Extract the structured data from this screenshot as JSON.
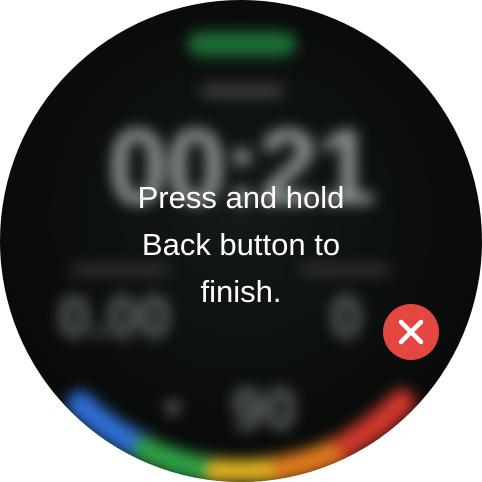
{
  "message": {
    "line1": "Press and hold",
    "line2": "Back button to",
    "line3": "finish."
  },
  "background": {
    "elapsed_time": "00:21",
    "left_metric": "0.00",
    "right_metric": "0",
    "heart_rate": "90"
  },
  "icons": {
    "close": "close-icon",
    "heart": "heart-icon"
  },
  "colors": {
    "close_button": "#e4473f",
    "status_green": "#1f7a3b",
    "arc_blue": "#2f6fd6",
    "arc_green": "#2e9e45",
    "arc_yellow": "#e3b522",
    "arc_orange": "#e07a1f",
    "arc_red": "#d1382d"
  }
}
